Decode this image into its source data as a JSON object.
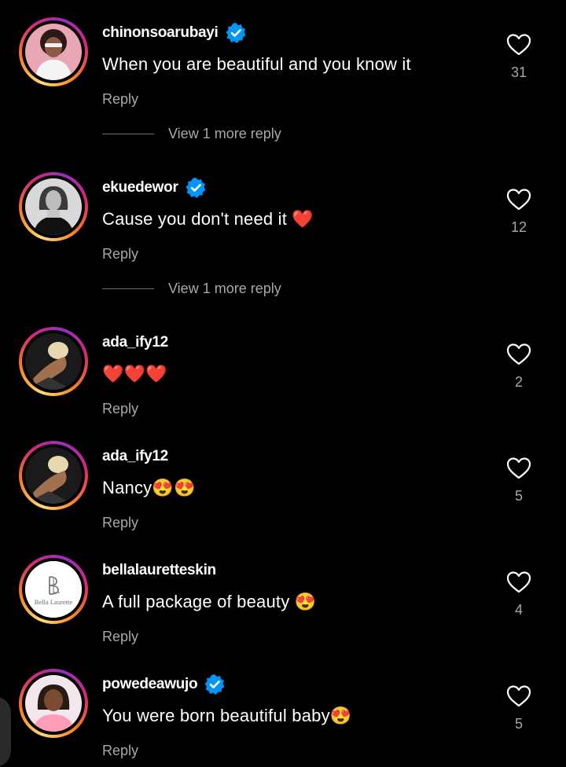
{
  "comments": [
    {
      "username": "chinonsoarubayi",
      "verified": true,
      "text": "When you are beautiful and you know it",
      "emoji": "",
      "reply_label": "Reply",
      "likes": "31",
      "view_more": "View 1 more reply"
    },
    {
      "username": "ekuedewor",
      "verified": true,
      "text": "Cause you don't need it ",
      "emoji": "❤️",
      "reply_label": "Reply",
      "likes": "12",
      "view_more": "View 1 more reply"
    },
    {
      "username": "ada_ify12",
      "verified": false,
      "text": "",
      "emoji": "❤️❤️❤️",
      "reply_label": "Reply",
      "likes": "2"
    },
    {
      "username": "ada_ify12",
      "verified": false,
      "text": "Nancy",
      "emoji": "😍😍",
      "reply_label": "Reply",
      "likes": "5"
    },
    {
      "username": "bellalauretteskin",
      "verified": false,
      "text": "A full package of beauty ",
      "emoji": "😍",
      "reply_label": "Reply",
      "likes": "4",
      "avatar_logo_text": "Bella Laurette"
    },
    {
      "username": "powedeawujo",
      "verified": true,
      "text": "You were born beautiful baby",
      "emoji": "😍",
      "reply_label": "Reply",
      "likes": "5"
    }
  ],
  "colors": {
    "background": "#000000",
    "text": "#ffffff",
    "secondary_text": "#a8a8a8",
    "verified_badge": "#0095f6"
  }
}
